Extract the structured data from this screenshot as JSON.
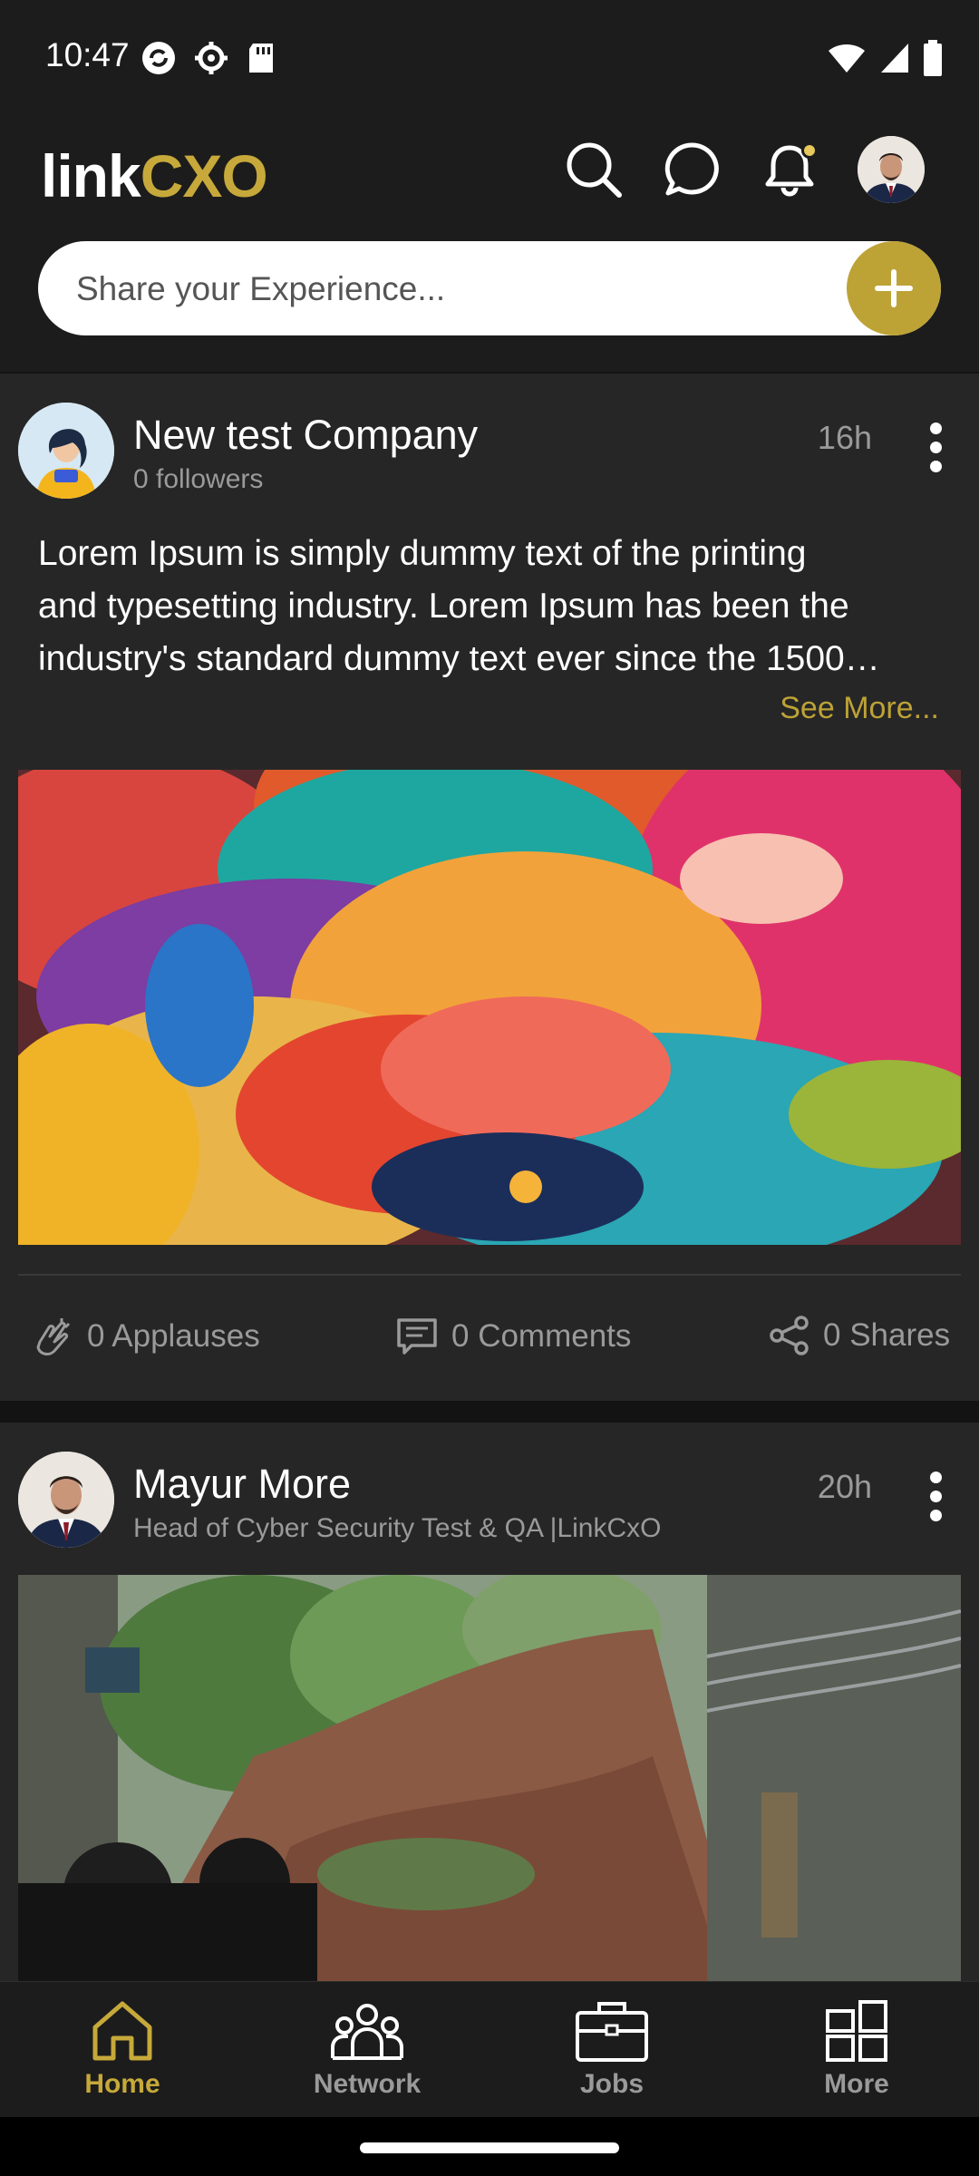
{
  "status_bar": {
    "time": "10:47"
  },
  "header": {
    "logo_part1": "link",
    "logo_part2": "CXO",
    "share_placeholder": "Share your Experience..."
  },
  "posts": [
    {
      "author": "New test Company",
      "subtitle": "0 followers",
      "time": "16h",
      "text_lines": [
        "Lorem Ipsum is simply dummy text of the printing",
        "and typesetting industry. Lorem Ipsum has been the",
        "industry's standard dummy text ever since the 1500…"
      ],
      "see_more": "See More...",
      "applauses": "0 Applauses",
      "comments": "0 Comments",
      "shares": "0 Shares"
    },
    {
      "author": "Mayur More",
      "subtitle": "Head of Cyber Security Test & QA |LinkCxO",
      "time": "20h"
    }
  ],
  "nav": [
    {
      "label": "Home",
      "icon": "home-icon",
      "active": true
    },
    {
      "label": "Network",
      "icon": "network-icon",
      "active": false
    },
    {
      "label": "Jobs",
      "icon": "briefcase-icon",
      "active": false
    },
    {
      "label": "More",
      "icon": "grid-icon",
      "active": false
    }
  ],
  "colors": {
    "accent": "#c6a93a",
    "background": "#1c1c1c",
    "card": "#262626",
    "muted_text": "#9a9a9a"
  }
}
